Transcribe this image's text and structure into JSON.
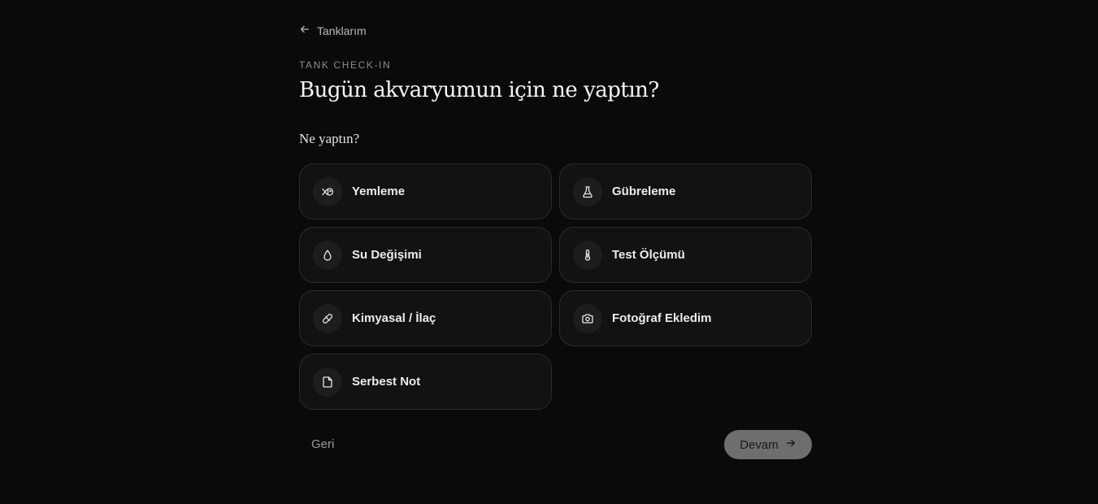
{
  "nav": {
    "back_label": "Tanklarım",
    "back_icon": "arrow-left-icon"
  },
  "header": {
    "eyebrow": "TANK CHECK-IN",
    "title": "Bugün akvaryumun için ne yaptın?"
  },
  "form": {
    "question": "Ne yaptın?"
  },
  "options": [
    {
      "label": "Yemleme",
      "icon": "fish-icon"
    },
    {
      "label": "Gübreleme",
      "icon": "flask-icon"
    },
    {
      "label": "Su Değişimi",
      "icon": "droplet-icon"
    },
    {
      "label": "Test Ölçümü",
      "icon": "thermometer-icon"
    },
    {
      "label": "Kimyasal / İlaç",
      "icon": "pill-icon"
    },
    {
      "label": "Fotoğraf Ekledim",
      "icon": "camera-icon"
    },
    {
      "label": "Serbest Not",
      "icon": "note-icon"
    }
  ],
  "footer": {
    "back_label": "Geri",
    "next_label": "Devam",
    "next_icon": "arrow-right-icon"
  },
  "colors": {
    "background": "#0a0a0a",
    "card": "#111211",
    "card_border": "#2a2a2a",
    "next_button": "#6e6e6c"
  }
}
